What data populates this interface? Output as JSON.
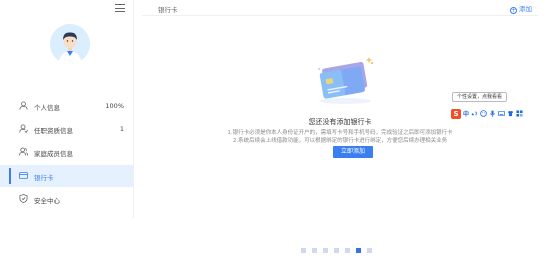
{
  "sidebar": {
    "items": [
      {
        "label": "个人信息",
        "value": "100%",
        "icon": "user-icon"
      },
      {
        "label": "任职资质信息",
        "value": "1",
        "icon": "user-badge-icon"
      },
      {
        "label": "家庭成员信息",
        "value": "",
        "icon": "family-icon"
      },
      {
        "label": "银行卡",
        "value": "",
        "icon": "card-icon",
        "active": true
      },
      {
        "label": "安全中心",
        "value": "",
        "icon": "shield-icon"
      }
    ]
  },
  "main": {
    "title": "银行卡",
    "add_label": "添加",
    "empty_title": "您还没有添加银行卡",
    "empty_desc_1": "1.银行卡必须是你本人身份证开户的，需填写卡号和手机号码，完成验证之后即可添加银行卡",
    "empty_desc_2": "2.系统后续会上线借款功能，可以根据绑定的银行卡进行绑定，方便您后续办理相关业务",
    "add_button": "立即添加"
  },
  "ime": {
    "tooltip": "个性设置，点我看看",
    "logo": "S",
    "lang": "中"
  },
  "pager": {
    "count": 7,
    "active_index": 5
  },
  "colors": {
    "accent": "#3b7ef0",
    "active_bg": "#e6f1ff",
    "ime_logo": "#f04e26"
  }
}
